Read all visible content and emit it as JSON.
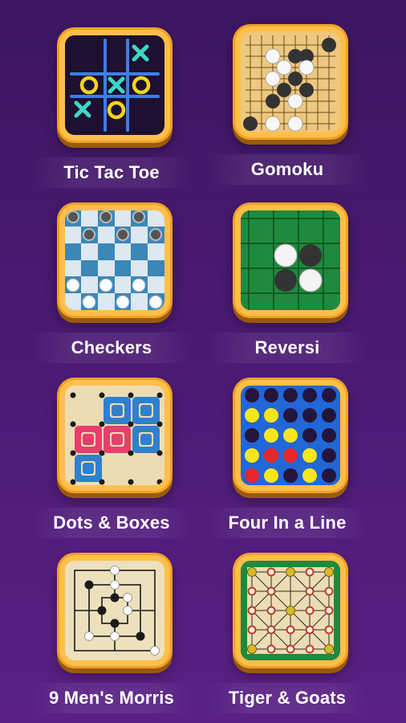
{
  "games": [
    {
      "id": "tic-tac-toe",
      "label": "Tic Tac Toe",
      "icon": "tic-tac-toe-board-icon"
    },
    {
      "id": "gomoku",
      "label": "Gomoku",
      "icon": "gomoku-board-icon"
    },
    {
      "id": "checkers",
      "label": "Checkers",
      "icon": "checkers-board-icon"
    },
    {
      "id": "reversi",
      "label": "Reversi",
      "icon": "reversi-board-icon"
    },
    {
      "id": "dots-boxes",
      "label": "Dots & Boxes",
      "icon": "dots-boxes-board-icon"
    },
    {
      "id": "four-in-a-line",
      "label": "Four In a Line",
      "icon": "four-in-a-line-board-icon"
    },
    {
      "id": "nine-mens-morris",
      "label": "9 Men's Morris",
      "icon": "nine-mens-morris-board-icon"
    },
    {
      "id": "tiger-goats",
      "label": "Tiger & Goats",
      "icon": "tiger-goats-board-icon"
    }
  ],
  "colors": {
    "background_top": "#3c1660",
    "background_bottom": "#5a2085",
    "tile_frame": "#f0a126",
    "tile_frame_shadow": "#9a5a0c",
    "label_text": "#ffffff"
  }
}
